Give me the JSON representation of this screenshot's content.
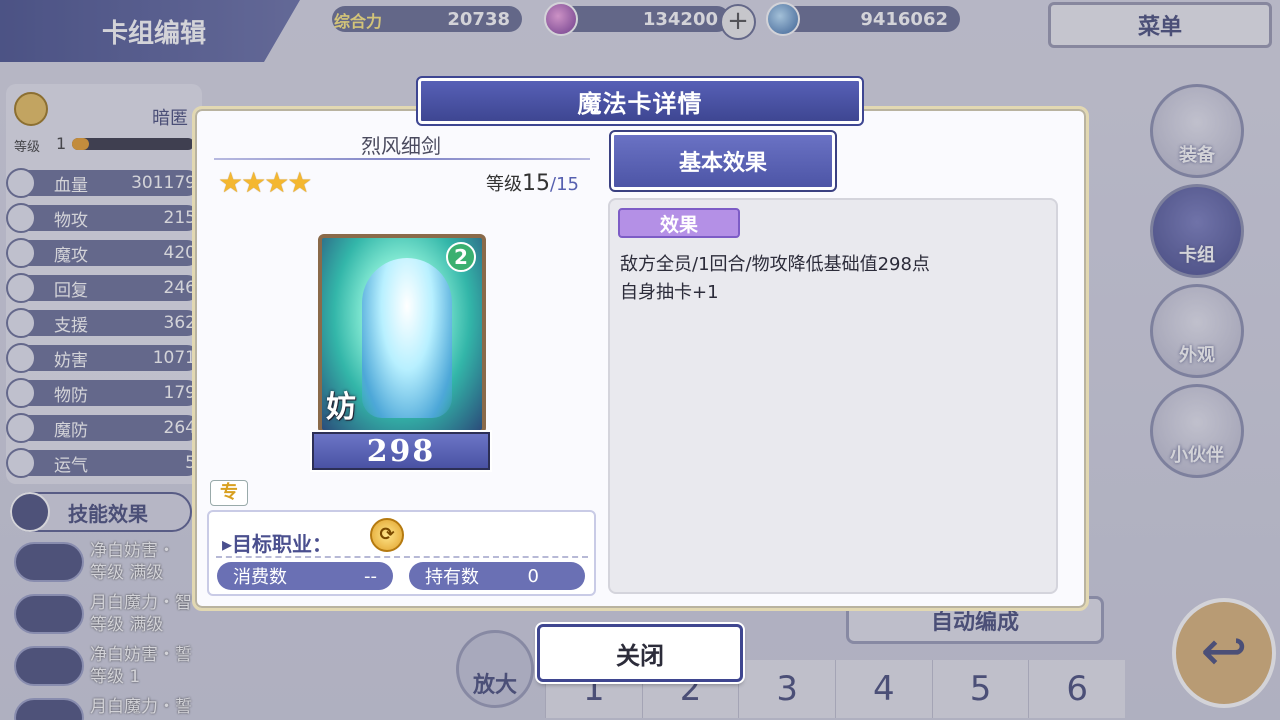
{
  "header": {
    "title": "卡组编辑",
    "power_label": "综合力",
    "power_value": "20738",
    "currency1_value": "134200",
    "currency2_value": "9416062",
    "plus_label": "+",
    "menu_label": "菜单"
  },
  "character": {
    "name": "暗匿",
    "level_label": "等级",
    "level_value": "1"
  },
  "stats": [
    {
      "label": "血量",
      "value": "301179"
    },
    {
      "label": "物攻",
      "value": "215"
    },
    {
      "label": "魔攻",
      "value": "420"
    },
    {
      "label": "回复",
      "value": "246"
    },
    {
      "label": "支援",
      "value": "362"
    },
    {
      "label": "妨害",
      "value": "1071"
    },
    {
      "label": "物防",
      "value": "179"
    },
    {
      "label": "魔防",
      "value": "264"
    },
    {
      "label": "运气",
      "value": "5"
    }
  ],
  "skills": {
    "header": "技能效果",
    "items": [
      {
        "line1": "净白妨害・",
        "line2": "等级 满级"
      },
      {
        "line1": "月白魔力・智",
        "line2": "等级 满级"
      },
      {
        "line1": "净白妨害・誓",
        "line2": "等级 1"
      },
      {
        "line1": "月白魔力・誓",
        "line2": ""
      }
    ]
  },
  "right_nav": [
    {
      "label": "装备"
    },
    {
      "label": "卡组"
    },
    {
      "label": "外观"
    },
    {
      "label": "小伙伴"
    }
  ],
  "bottom": {
    "zoom_label": "放大",
    "auto_label": "自动编成",
    "tabs": [
      "1",
      "2",
      "3",
      "4",
      "5",
      "6"
    ],
    "back_icon": "↩"
  },
  "modal": {
    "title": "魔法卡详情",
    "card_name": "烈风细剑",
    "stars": "★★★★",
    "star_count": 4,
    "level_label": "等级",
    "level_current": "15",
    "level_max": "/15",
    "card_cost": "2",
    "card_glyph": "妨",
    "card_value": "298",
    "exclusive_tag": "专",
    "target_job_label": "目标职业：",
    "consume_label": "消费数",
    "consume_value": "--",
    "owned_label": "持有数",
    "owned_value": "0",
    "basic_effect_tab": "基本效果",
    "effect_badge": "效果",
    "effect_lines": [
      "敌方全员/1回合/物攻降低基础值298点",
      "自身抽卡+1"
    ],
    "close_label": "关闭"
  }
}
